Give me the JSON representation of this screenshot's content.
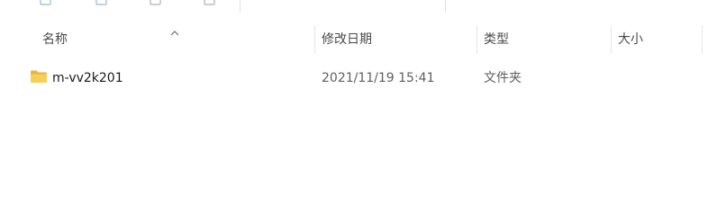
{
  "columns": {
    "name": "名称",
    "modified": "修改日期",
    "type": "类型",
    "size": "大小"
  },
  "files": [
    {
      "name": "m-vv2k201",
      "modified": "2021/11/19 15:41",
      "type": "文件夹",
      "size": "",
      "icon": "folder-icon"
    }
  ],
  "colors": {
    "folder": "#f2c94c",
    "divider": "#e5e5e5",
    "header_text": "#4a4a4a"
  }
}
